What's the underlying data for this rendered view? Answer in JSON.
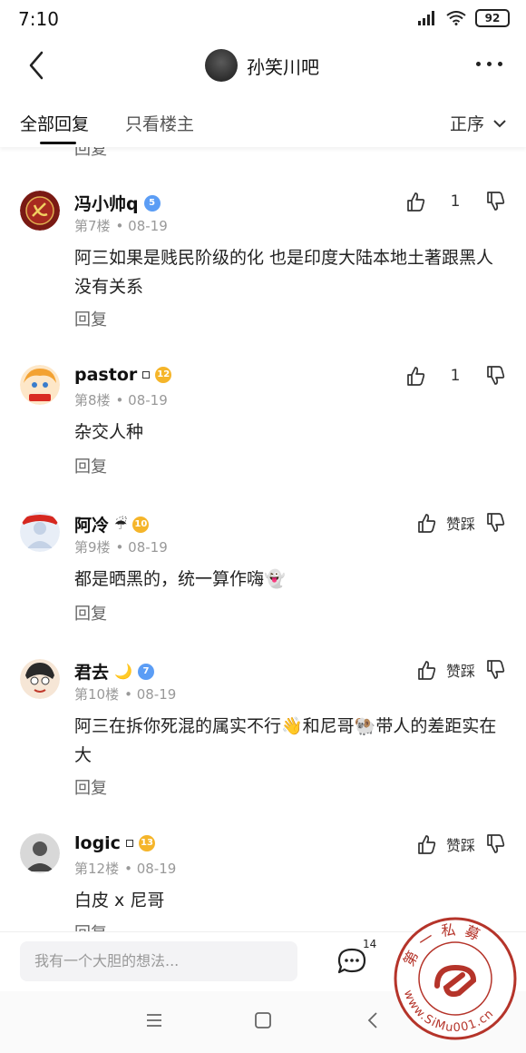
{
  "status": {
    "time": "7:10",
    "battery": "92"
  },
  "header": {
    "title": "孙笑川吧"
  },
  "tabs": {
    "all": "全部回复",
    "op_only": "只看楼主",
    "sort": "正序"
  },
  "stub_reply": "回复",
  "posts": [
    {
      "user": "冯小帅q",
      "level": "5",
      "floor": "第7楼",
      "date": "08-19",
      "text": "阿三如果是贱民阶级的化 也是印度大陆本地土著跟黑人没有关系",
      "reply": "回复",
      "likes": "1"
    },
    {
      "user": "pastor",
      "level": "12",
      "floor": "第8楼",
      "date": "08-19",
      "text": "杂交人种",
      "reply": "回复",
      "likes": "1"
    },
    {
      "user": "阿冷",
      "level": "10",
      "floor": "第9楼",
      "date": "08-19",
      "text": "都是晒黑的，统一算作嗨👻",
      "reply": "回复",
      "like_label": "赞踩"
    },
    {
      "user": "君去",
      "level": "7",
      "floor": "第10楼",
      "date": "08-19",
      "text": "阿三在拆你死混的属实不行👋和尼哥🐏带人的差距实在大",
      "reply": "回复",
      "like_label": "赞踩"
    },
    {
      "user": "logic",
      "level": "13",
      "floor": "第12楼",
      "date": "08-19",
      "text": "白皮 x 尼哥",
      "reply": "回复",
      "like_label": "赞踩"
    }
  ],
  "emoji": {
    "umbrella": "☔",
    "moon": "🌙"
  },
  "bottom": {
    "placeholder": "我有一个大胆的想法...",
    "comment_count": "14"
  },
  "watermark": {
    "text": "第一私募",
    "url": "www.SiMu001.cn"
  },
  "colors": {
    "level_blue": "#5b9df5",
    "level_gold": "#f5b52a",
    "watermark_red": "#b5342a"
  }
}
